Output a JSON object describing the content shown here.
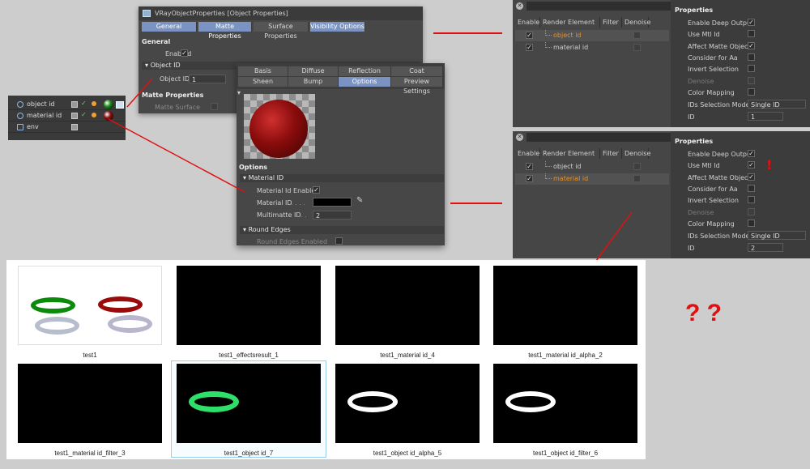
{
  "outliner": {
    "rows": [
      {
        "label": "object id",
        "swatch": "#1f8a1f"
      },
      {
        "label": "material id",
        "swatch": "#8c1010"
      },
      {
        "label": "env",
        "swatch": ""
      }
    ]
  },
  "object_props": {
    "title": "VRayObjectProperties [Object Properties]",
    "tabs": [
      "General",
      "Matte Properties",
      "Surface Properties",
      "Visibility Options"
    ],
    "general_label": "General",
    "enabled_label": "Enabled",
    "object_id_section": "Object ID",
    "object_id_label": "Object ID",
    "object_id_value": "1",
    "matte_props_label": "Matte Properties",
    "matte_surface_label": "Matte Surface"
  },
  "material": {
    "tabs_row1": [
      "Basis",
      "Diffuse",
      "Reflection",
      "Coat"
    ],
    "tabs_row2": [
      "Sheen",
      "Bump",
      "Options",
      "Preview Settings"
    ],
    "options_label": "Options",
    "material_id_section": "Material ID",
    "material_id_enabled_label": "Material Id Enabled",
    "material_id_label": "Material ID",
    "multimatte_id_label": "Multimatte ID",
    "multimatte_id_value": "2",
    "round_edges_section": "Round Edges",
    "round_edges_enabled_label": "Round Edges Enabled"
  },
  "render_elements_top": {
    "headers": [
      "Enable",
      "Render Element",
      "Filter",
      "Denoise"
    ],
    "rows": [
      {
        "name": "object id",
        "highlight": true
      },
      {
        "name": "material id",
        "highlight": false
      }
    ],
    "properties_title": "Properties",
    "props": [
      {
        "label": "Enable Deep Output",
        "checked": true,
        "disabled": false
      },
      {
        "label": "Use Mtl Id",
        "checked": false,
        "disabled": false
      },
      {
        "label": "Affect Matte Objects",
        "checked": true,
        "disabled": false
      },
      {
        "label": "Consider for Aa",
        "checked": false,
        "disabled": false
      },
      {
        "label": "Invert Selection",
        "checked": false,
        "disabled": false
      },
      {
        "label": "Denoise",
        "checked": false,
        "disabled": true
      },
      {
        "label": "Color Mapping",
        "checked": false,
        "disabled": false
      }
    ],
    "ids_selection_label": "IDs Selection Mode",
    "ids_selection_value": "Single ID",
    "id_label": "ID",
    "id_value": "1"
  },
  "render_elements_bottom": {
    "headers": [
      "Enable",
      "Render Element",
      "Filter",
      "Denoise"
    ],
    "rows": [
      {
        "name": "object id",
        "highlight": false
      },
      {
        "name": "material id",
        "highlight": true
      }
    ],
    "properties_title": "Properties",
    "props": [
      {
        "label": "Enable Deep Output",
        "checked": true,
        "disabled": false
      },
      {
        "label": "Use Mtl Id",
        "checked": true,
        "disabled": false
      },
      {
        "label": "Affect Matte Objects",
        "checked": true,
        "disabled": false
      },
      {
        "label": "Consider for Aa",
        "checked": false,
        "disabled": false
      },
      {
        "label": "Invert Selection",
        "checked": false,
        "disabled": false
      },
      {
        "label": "Denoise",
        "checked": false,
        "disabled": true
      },
      {
        "label": "Color Mapping",
        "checked": false,
        "disabled": false
      }
    ],
    "ids_selection_label": "IDs Selection Mode",
    "ids_selection_value": "Single ID",
    "id_label": "ID",
    "id_value": "2",
    "exclamation": "!"
  },
  "question_marks": "? ?",
  "thumbnails": [
    {
      "caption": "test1"
    },
    {
      "caption": "test1_effectsresult_1"
    },
    {
      "caption": "test1_material id_4"
    },
    {
      "caption": "test1_material id_alpha_2"
    },
    {
      "caption": "test1_material id_filter_3"
    },
    {
      "caption": "test1_object id_7"
    },
    {
      "caption": "test1_object id_alpha_5"
    },
    {
      "caption": "test1_object id_filter_6"
    }
  ],
  "colors": {
    "accent_tab": "#7b93c2",
    "highlight_text": "#e8922a",
    "arrow_red": "#e01010"
  }
}
